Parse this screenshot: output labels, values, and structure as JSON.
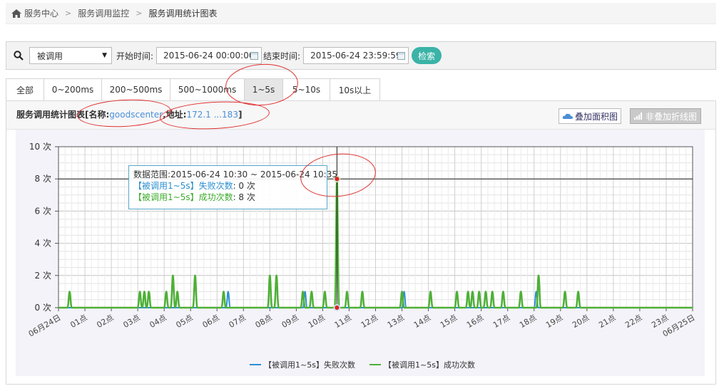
{
  "breadcrumb": {
    "items": [
      "服务中心",
      "服务调用监控"
    ],
    "current": "服务调用统计图表"
  },
  "filter": {
    "select_value": "被调用",
    "start_label": "开始时间:",
    "start_value": "2015-06-24 00:00:00",
    "end_label": "结束时间:",
    "end_value": "2015-06-24 23:59:59",
    "search_label": "检索"
  },
  "tabs": [
    "全部",
    "0~200ms",
    "200~500ms",
    "500~1000ms",
    "1~5s",
    "5~10s",
    "10s以上"
  ],
  "active_tab": "1~5s",
  "panel": {
    "title_prefix": "服务调用统计图表[名称:",
    "name_value": "goodscenter",
    "addr_label": ",地址:",
    "addr_value": "172.1 ...183",
    "title_suffix": "]",
    "btn_area": "叠加面积图",
    "btn_line": "非叠加折线图"
  },
  "tooltip": {
    "range": "数据范围:2015-06-24 10:30 ~ 2015-06-24 10:35",
    "fail_label": "【被调用1~5s】失败次数",
    "fail_value": ": 0 次",
    "ok_label": "【被调用1~5s】成功次数",
    "ok_value": ": 8 次"
  },
  "colors": {
    "fail": "#2b8fd1",
    "success": "#4db036",
    "accent": "#3bb3a7",
    "annotation": "#e03030"
  },
  "chart_data": {
    "type": "line",
    "ylim": [
      0,
      10
    ],
    "y_ticks": [
      "0 次",
      "2 次",
      "4 次",
      "6 次",
      "8 次",
      "10 次"
    ],
    "x_ticks": [
      "06月24日",
      "01点",
      "02点",
      "03点",
      "04点",
      "05点",
      "06点",
      "07点",
      "08点",
      "09点",
      "10点",
      "11点",
      "12点",
      "13点",
      "14点",
      "15点",
      "16点",
      "17点",
      "18点",
      "19点",
      "20点",
      "21点",
      "22点",
      "23点",
      "06月25日"
    ],
    "x_range_hours": [
      0,
      24
    ],
    "series": [
      {
        "name": "【被调用1~5s】失败次数",
        "points": [
          [
            6.42,
            1
          ],
          [
            9.33,
            1
          ],
          [
            13.08,
            1
          ],
          [
            18.08,
            1
          ]
        ]
      },
      {
        "name": "【被调用1~5s】成功次数",
        "points": [
          [
            0.42,
            1
          ],
          [
            3.08,
            1
          ],
          [
            3.25,
            1
          ],
          [
            3.42,
            1
          ],
          [
            4.08,
            1
          ],
          [
            4.33,
            2
          ],
          [
            4.5,
            1
          ],
          [
            5.17,
            2
          ],
          [
            6.25,
            1
          ],
          [
            8.0,
            2
          ],
          [
            8.25,
            2
          ],
          [
            9.25,
            1
          ],
          [
            9.58,
            1
          ],
          [
            10.08,
            1
          ],
          [
            10.54,
            8
          ],
          [
            10.92,
            1
          ],
          [
            11.5,
            1
          ],
          [
            13.0,
            1
          ],
          [
            14.08,
            1
          ],
          [
            15.08,
            1
          ],
          [
            15.5,
            1
          ],
          [
            15.67,
            1
          ],
          [
            15.92,
            1
          ],
          [
            16.17,
            1
          ],
          [
            16.42,
            1
          ],
          [
            16.83,
            1
          ],
          [
            17.5,
            1
          ],
          [
            18.17,
            2
          ],
          [
            19.17,
            1
          ],
          [
            19.67,
            1
          ]
        ]
      }
    ],
    "crosshair_hour": 10.54,
    "legend": [
      "【被调用1~5s】失败次数",
      "【被调用1~5s】成功次数"
    ],
    "legend_position": "bottom-center",
    "grid": true
  }
}
